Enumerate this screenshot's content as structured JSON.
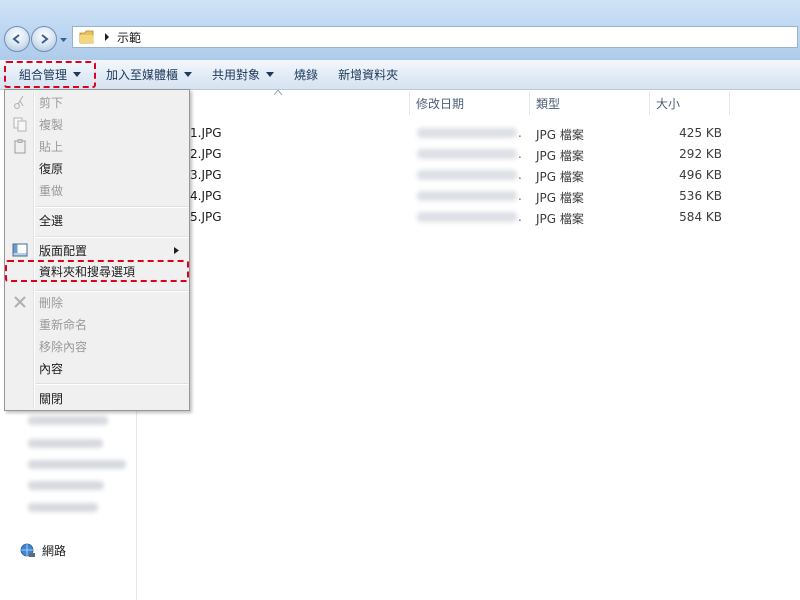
{
  "address": {
    "path": "示範"
  },
  "toolbar": {
    "organize": "組合管理",
    "add_to_library": "加入至媒體櫃",
    "share_with": "共用對象",
    "burn": "燒錄",
    "new_folder": "新增資料夾"
  },
  "columns": {
    "name": "",
    "date_modified": "修改日期",
    "type": "類型",
    "size": "大小"
  },
  "files": [
    {
      "name": "1.JPG",
      "type": "JPG 檔案",
      "size": "425 KB"
    },
    {
      "name": "2.JPG",
      "type": "JPG 檔案",
      "size": "292 KB"
    },
    {
      "name": "3.JPG",
      "type": "JPG 檔案",
      "size": "496 KB"
    },
    {
      "name": "4.JPG",
      "type": "JPG 檔案",
      "size": "536 KB"
    },
    {
      "name": "5.JPG",
      "type": "JPG 檔案",
      "size": "584 KB"
    }
  ],
  "menu": {
    "cut": "剪下",
    "copy": "複製",
    "paste": "貼上",
    "undo": "復原",
    "redo": "重做",
    "select_all": "全選",
    "layout": "版面配置",
    "folder_options": "資料夾和搜尋選項",
    "delete": "刪除",
    "rename": "重新命名",
    "remove_properties": "移除內容",
    "properties": "內容",
    "close": "關閉"
  },
  "navpane": {
    "network": "網路"
  },
  "colors": {
    "highlight_dash": "#e0001b",
    "toolbar_text": "#1e395b"
  }
}
